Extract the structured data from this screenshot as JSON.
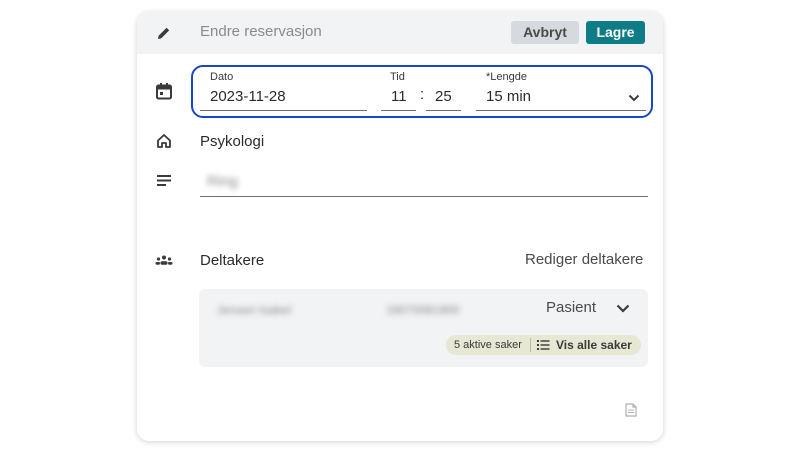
{
  "header": {
    "title": "Endre reservasjon",
    "cancel_label": "Avbryt",
    "save_label": "Lagre"
  },
  "datetime": {
    "date_label": "Dato",
    "date_value": "2023-11-28",
    "time_label": "Tid",
    "hour_value": "11",
    "separator": ":",
    "minute_value": "25",
    "length_label": "*Lengde",
    "length_value": "15 min"
  },
  "location": {
    "name": "Psykologi"
  },
  "description": {
    "value": "Ring"
  },
  "participants": {
    "label": "Deltakere",
    "edit_label": "Rediger deltakere",
    "items": [
      {
        "name": "Jensen Isabel",
        "id": "19070081900",
        "role": "Pasient",
        "active_cases": "5 aktive saker",
        "show_all": "Vis alle saker"
      }
    ]
  },
  "colors": {
    "accent": "#0e7c86",
    "focus": "#1746c6",
    "header_bg": "#f2f3f5",
    "badge_bg": "#e6e8d4"
  },
  "icons": {
    "header": "pencil-icon",
    "date": "calendar-icon",
    "location": "home-icon",
    "description": "notes-icon",
    "participants": "group-icon",
    "role_toggle": "chevron-down-icon",
    "length_toggle": "chevron-down-icon",
    "cases": "list-icon",
    "footer": "document-icon"
  }
}
